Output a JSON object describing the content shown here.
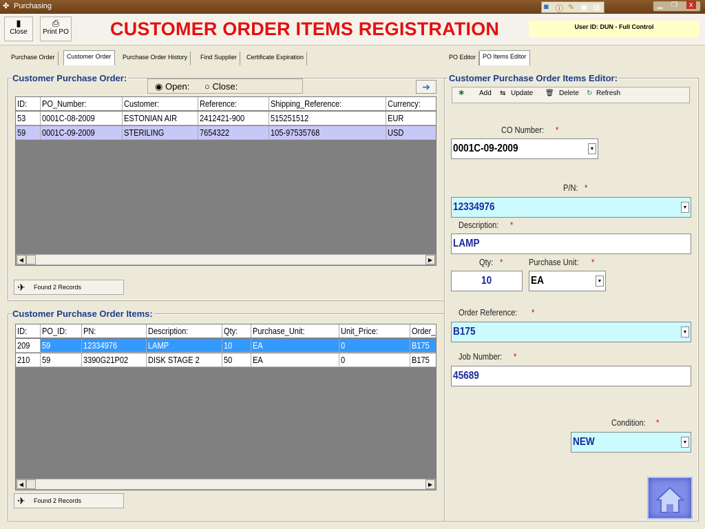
{
  "window": {
    "title": "Purchasing"
  },
  "toolbar": {
    "close_label": "Close",
    "print_label": "Print PO"
  },
  "page_title": "CUSTOMER ORDER ITEMS REGISTRATION",
  "user_info": "User ID: DUN - Full Control",
  "tabs_left": [
    "Purchase Order",
    "Customer Order",
    "Purchase Order History",
    "Find Supplier",
    "Certificate Expiration"
  ],
  "tabs_right": [
    "PO Editor",
    "PO Items Editor"
  ],
  "po_panel": {
    "title": "Customer Purchase Order:",
    "filter": {
      "open_label": "Open:",
      "close_label": "Close:",
      "selected": "Open:"
    },
    "columns": [
      "ID:",
      "PO_Number:",
      "Customer:",
      "Reference:",
      "Shipping_Reference:",
      "Currency:"
    ],
    "rows": [
      [
        "53",
        "0001C-08-2009",
        "ESTONIAN AIR",
        "2412421-900",
        "515251512",
        "EUR"
      ],
      [
        "59",
        "0001C-09-2009",
        "STERILING",
        "7654322",
        "105-97535768",
        "USD"
      ]
    ],
    "status": "Found 2 Records"
  },
  "items_panel": {
    "title": "Customer Purchase Order Items:",
    "columns": [
      "ID:",
      "PO_ID:",
      "PN:",
      "Description:",
      "Qty:",
      "Purchase_Unit:",
      "Unit_Price:",
      "Order_"
    ],
    "rows": [
      [
        "209",
        "59",
        "12334976",
        "LAMP",
        "10",
        "EA",
        "0",
        "B175"
      ],
      [
        "210",
        "59",
        "3390G21P02",
        "DISK STAGE 2",
        "50",
        "EA",
        "0",
        "B175"
      ]
    ],
    "status": "Found 2 Records"
  },
  "editor": {
    "title": "Customer Purchase Order Items Editor:",
    "buttons": {
      "add": "Add",
      "update": "Update",
      "delete": "Delete",
      "refresh": "Refresh"
    },
    "required_mark": "*",
    "co_number": {
      "label": "CO Number:",
      "value": "0001C-09-2009"
    },
    "pn": {
      "label": "P/N:",
      "value": "12334976"
    },
    "description": {
      "label": "Description:",
      "value": "LAMP"
    },
    "qty": {
      "label": "Qty:",
      "value": "10"
    },
    "purchase_unit": {
      "label": "Purchase Unit:",
      "value": "EA"
    },
    "order_reference": {
      "label": "Order Reference:",
      "value": "B175"
    },
    "job_number": {
      "label": "Job Number:",
      "value": "45689"
    },
    "condition": {
      "label": "Condition:",
      "value": "NEW"
    }
  },
  "colors": {
    "title_red": "#e41010",
    "selected_row": "#c8c8f8",
    "highlight_row": "#3399ff",
    "field_cyan": "#ccfbff",
    "label_blue": "#1c3c8c"
  }
}
